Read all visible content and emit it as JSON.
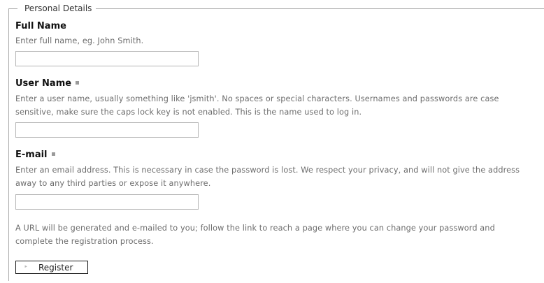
{
  "fieldset": {
    "legend": "Personal Details"
  },
  "full_name": {
    "label": "Full Name",
    "help": "Enter full name, eg. John Smith.",
    "value": ""
  },
  "user_name": {
    "label": "User Name",
    "help": "Enter a user name, usually something like 'jsmith'. No spaces or special characters. Usernames and passwords are case sensitive, make sure the caps lock key is not enabled. This is the name used to log in.",
    "value": ""
  },
  "email": {
    "label": "E-mail",
    "help": "Enter an email address. This is necessary in case the password is lost. We respect your privacy, and will not give the address away to any third parties or expose it anywhere.",
    "value": ""
  },
  "note": "A URL will be generated and e-mailed to you; follow the link to reach a page where you can change your password and complete the registration process.",
  "register_button": {
    "label": "Register",
    "icon": "arrow-right-icon"
  }
}
